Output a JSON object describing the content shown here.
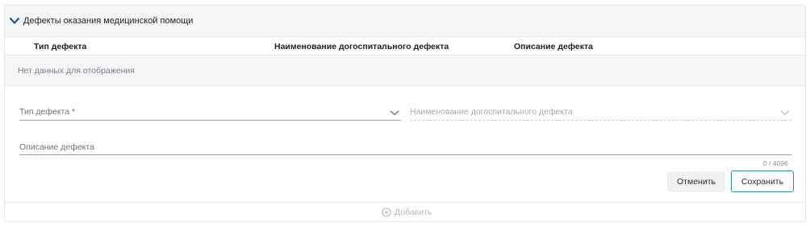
{
  "section": {
    "title": "Дефекты оказания медицинской помощи",
    "expand_icon": "chevron-down-icon"
  },
  "grid": {
    "columns": [
      "Тип дефекта",
      "Наименование догоспитального дефекта",
      "Описание дефекта"
    ],
    "empty_text": "Нет данных для отображения"
  },
  "form": {
    "defect_type_label": "Тип дефекта *",
    "prehospital_defect_label": "Наименование догоспитального дефекта",
    "description_label": "Описание дефекта",
    "description_counter": "0 / 4096",
    "cancel_label": "Отменить",
    "save_label": "Сохранить"
  },
  "footer": {
    "add_label": "Добавить",
    "add_icon": "plus-circle-icon"
  },
  "colors": {
    "accent": "#2a8f8f",
    "chevron": "#1d5a8a"
  }
}
